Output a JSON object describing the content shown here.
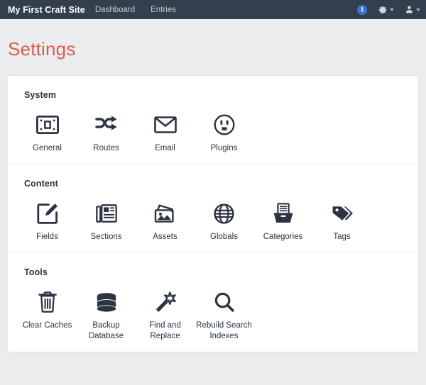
{
  "header": {
    "site_name": "My First Craft Site",
    "nav": [
      {
        "label": "Dashboard"
      },
      {
        "label": "Entries"
      }
    ],
    "notification_count": "1",
    "gear_icon": "gear-icon",
    "user_icon": "user-icon",
    "badge_color": "#3f72d8",
    "background_color": "#333f4d"
  },
  "page": {
    "title": "Settings",
    "title_color": "#d9604f",
    "background_color": "#ebecee"
  },
  "sections": [
    {
      "id": "system",
      "heading": "System",
      "items": [
        {
          "label": "General",
          "icon": "general-frame-icon"
        },
        {
          "label": "Routes",
          "icon": "shuffle-arrows-icon"
        },
        {
          "label": "Email",
          "icon": "envelope-icon"
        },
        {
          "label": "Plugins",
          "icon": "power-outlet-icon"
        }
      ]
    },
    {
      "id": "content",
      "heading": "Content",
      "items": [
        {
          "label": "Fields",
          "icon": "pencil-square-icon"
        },
        {
          "label": "Sections",
          "icon": "newspaper-icon"
        },
        {
          "label": "Assets",
          "icon": "photos-icon"
        },
        {
          "label": "Globals",
          "icon": "globe-icon"
        },
        {
          "label": "Categories",
          "icon": "file-box-icon"
        },
        {
          "label": "Tags",
          "icon": "tags-icon"
        }
      ]
    },
    {
      "id": "tools",
      "heading": "Tools",
      "items": [
        {
          "label": "Clear Caches",
          "icon": "trash-icon"
        },
        {
          "label": "Backup Database",
          "icon": "database-icon"
        },
        {
          "label": "Find and Replace",
          "icon": "magic-wand-icon"
        },
        {
          "label": "Rebuild Search Indexes",
          "icon": "magnifier-icon"
        }
      ]
    }
  ]
}
